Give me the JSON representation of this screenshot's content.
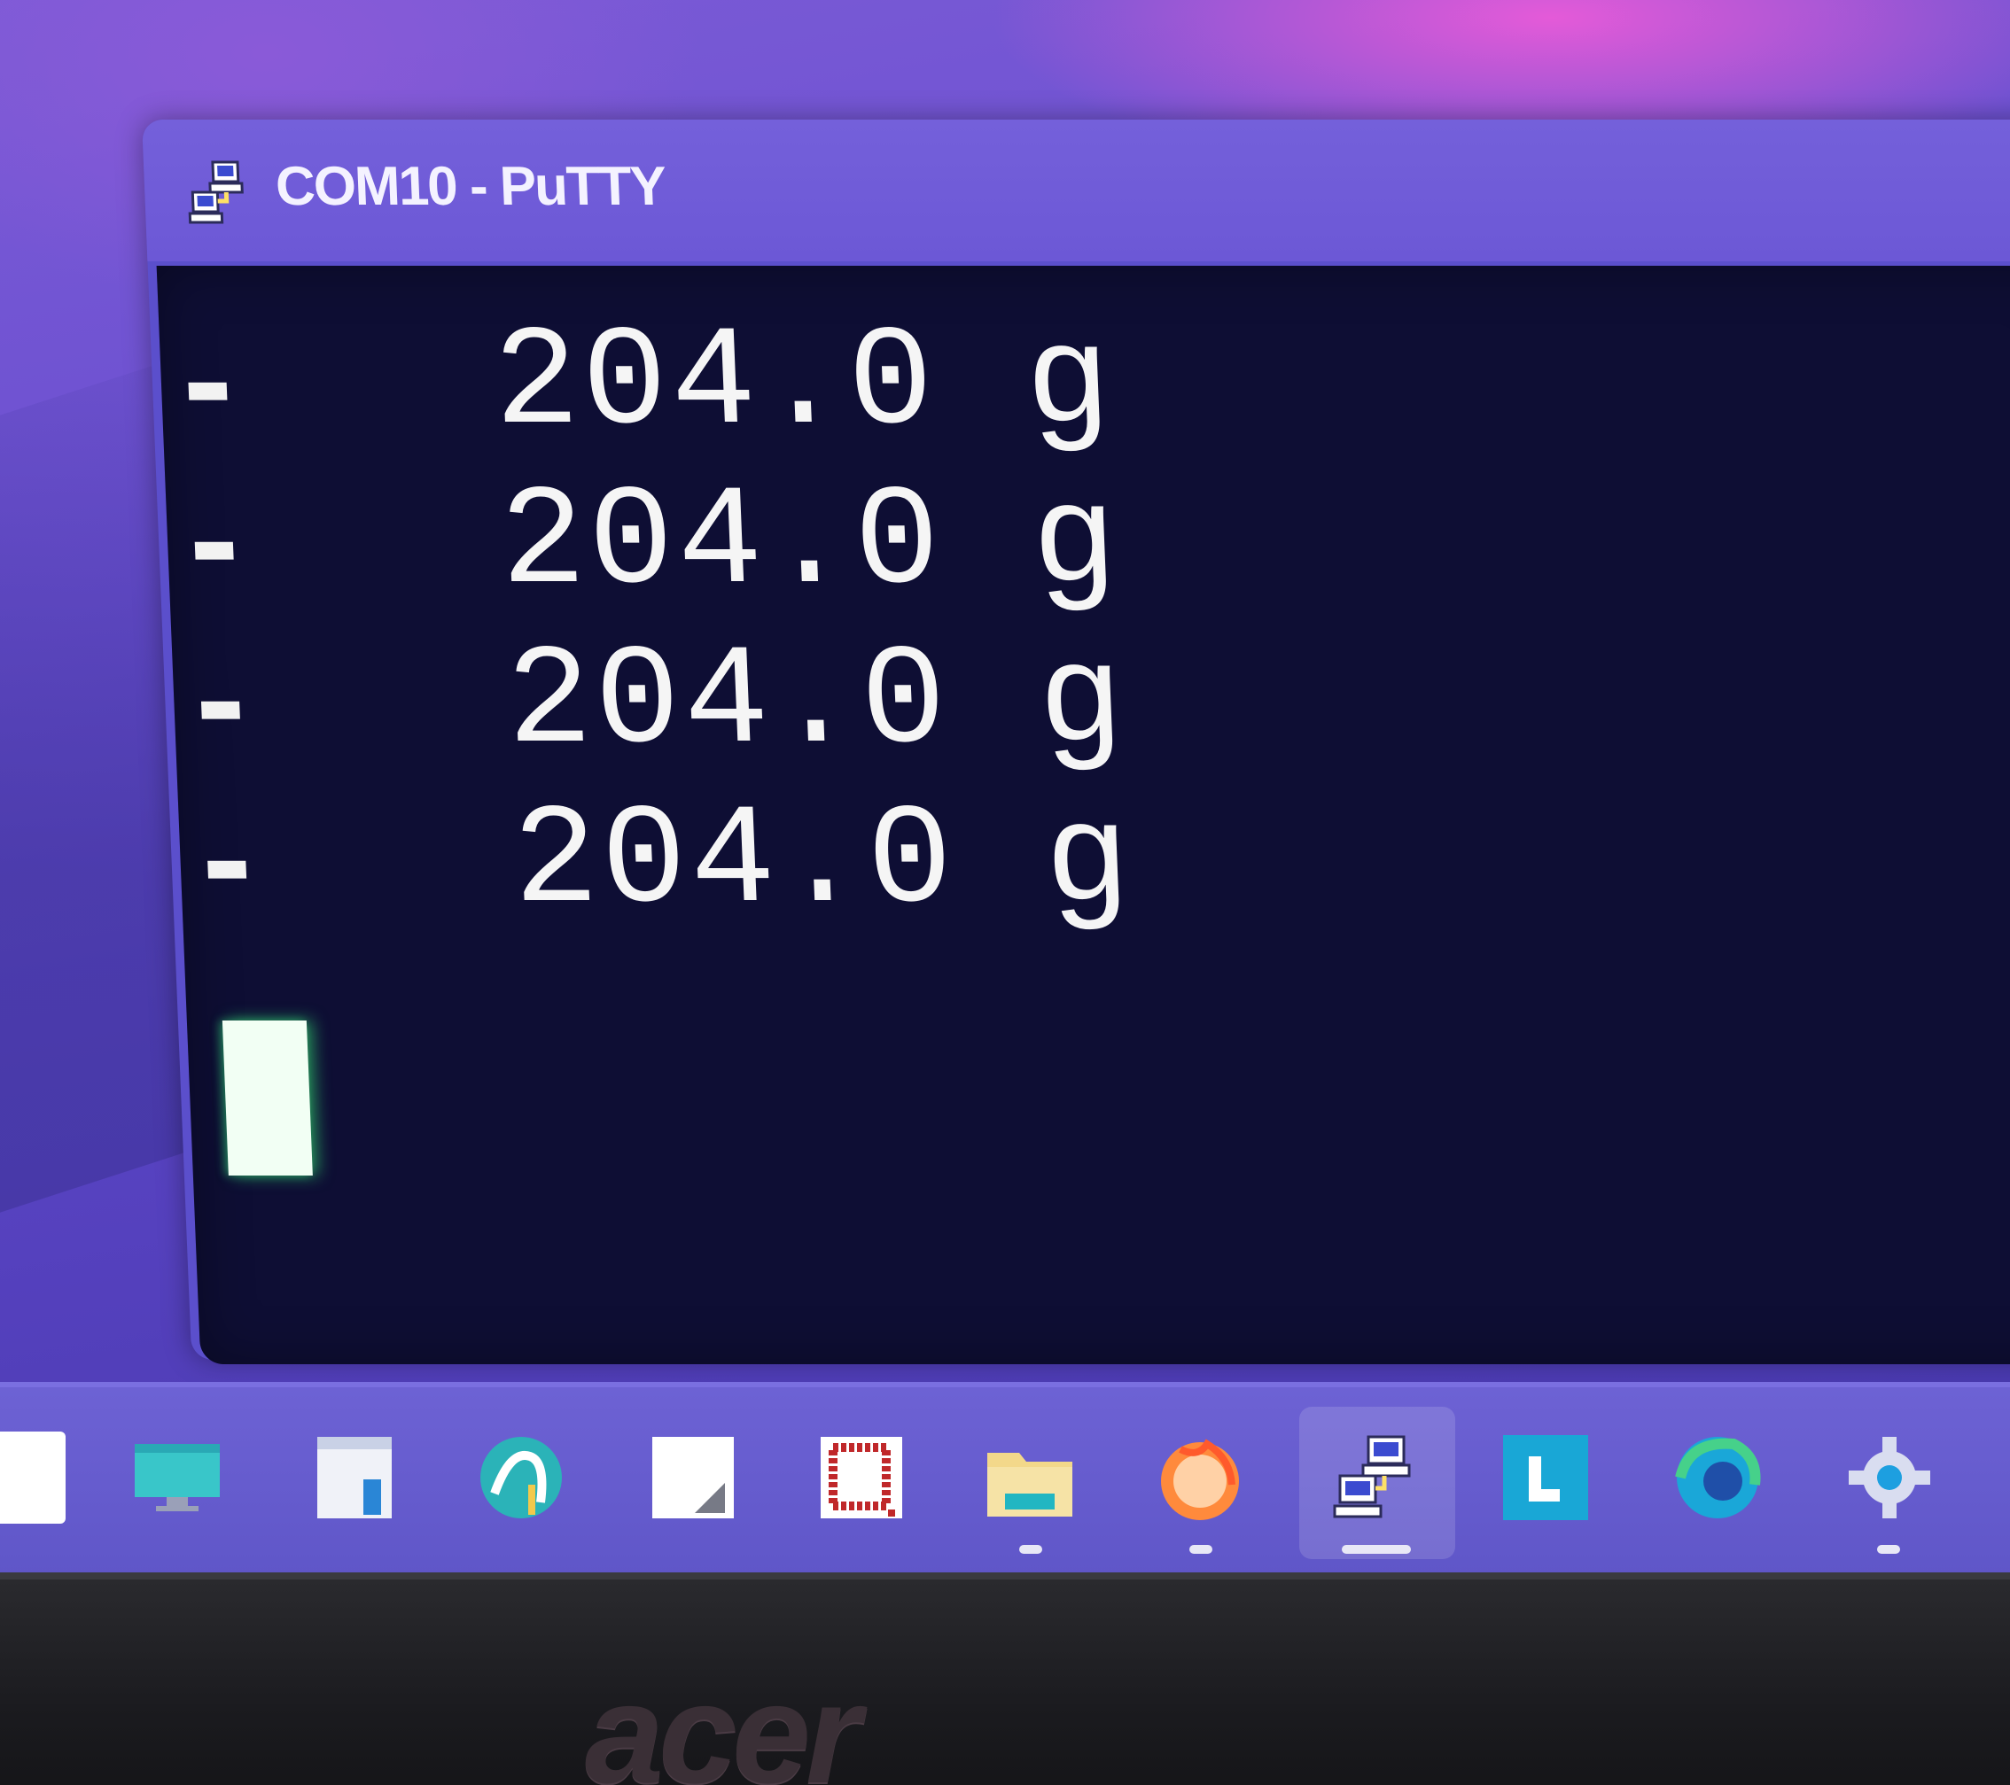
{
  "window": {
    "title": "COM10 - PuTTY",
    "icon": "putty-icon"
  },
  "terminal": {
    "lines": [
      {
        "prefix": "-",
        "text": "204.0 g"
      },
      {
        "prefix": "-",
        "text": "204.0 g"
      },
      {
        "prefix": "-",
        "text": "204.0 g"
      },
      {
        "prefix": "-",
        "text": "204.0 g"
      }
    ],
    "foreground": "#f5f5f5",
    "background": "#0e0e34",
    "cursor_color": "#f2fff4"
  },
  "taskbar": {
    "icons": [
      {
        "name": "app-partial-icon",
        "running": false
      },
      {
        "name": "monitor-app-icon",
        "running": false
      },
      {
        "name": "document-app-icon",
        "running": false
      },
      {
        "name": "arduino-app-icon",
        "running": false
      },
      {
        "name": "notepad-app-icon",
        "running": false
      },
      {
        "name": "red-frame-app-icon",
        "running": false
      },
      {
        "name": "file-explorer-icon",
        "running": true
      },
      {
        "name": "firefox-icon",
        "running": true
      },
      {
        "name": "putty-icon",
        "running": true,
        "active": true
      },
      {
        "name": "l-app-icon",
        "running": false
      },
      {
        "name": "edge-icon",
        "running": false
      },
      {
        "name": "settings-gear-icon",
        "running": true
      }
    ]
  },
  "monitor": {
    "brand": "acer"
  },
  "colors": {
    "taskbar": "#6d62d4",
    "titlebar": "#7460da",
    "terminal_bg": "#0e0e34"
  }
}
